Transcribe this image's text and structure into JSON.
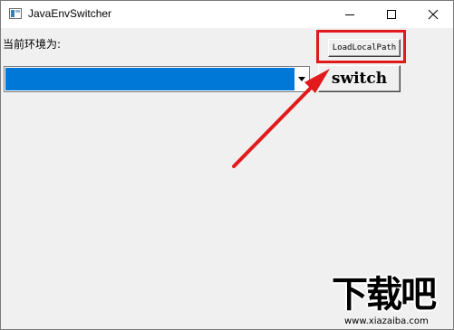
{
  "window": {
    "title": "JavaEnvSwitcher",
    "controls": [
      "minimize",
      "maximize",
      "close"
    ]
  },
  "main": {
    "env_label": "当前环境为:",
    "load_button_label": "LoadLocalPath",
    "switch_button_label": "switch",
    "combo_value": ""
  },
  "annotation": {
    "color": "#e11b1b"
  },
  "watermark": {
    "main_text": "下载吧",
    "url": "www.xiazaiba.com"
  },
  "colors": {
    "selection": "#0078d7",
    "window_bg": "#f0f0f0"
  }
}
